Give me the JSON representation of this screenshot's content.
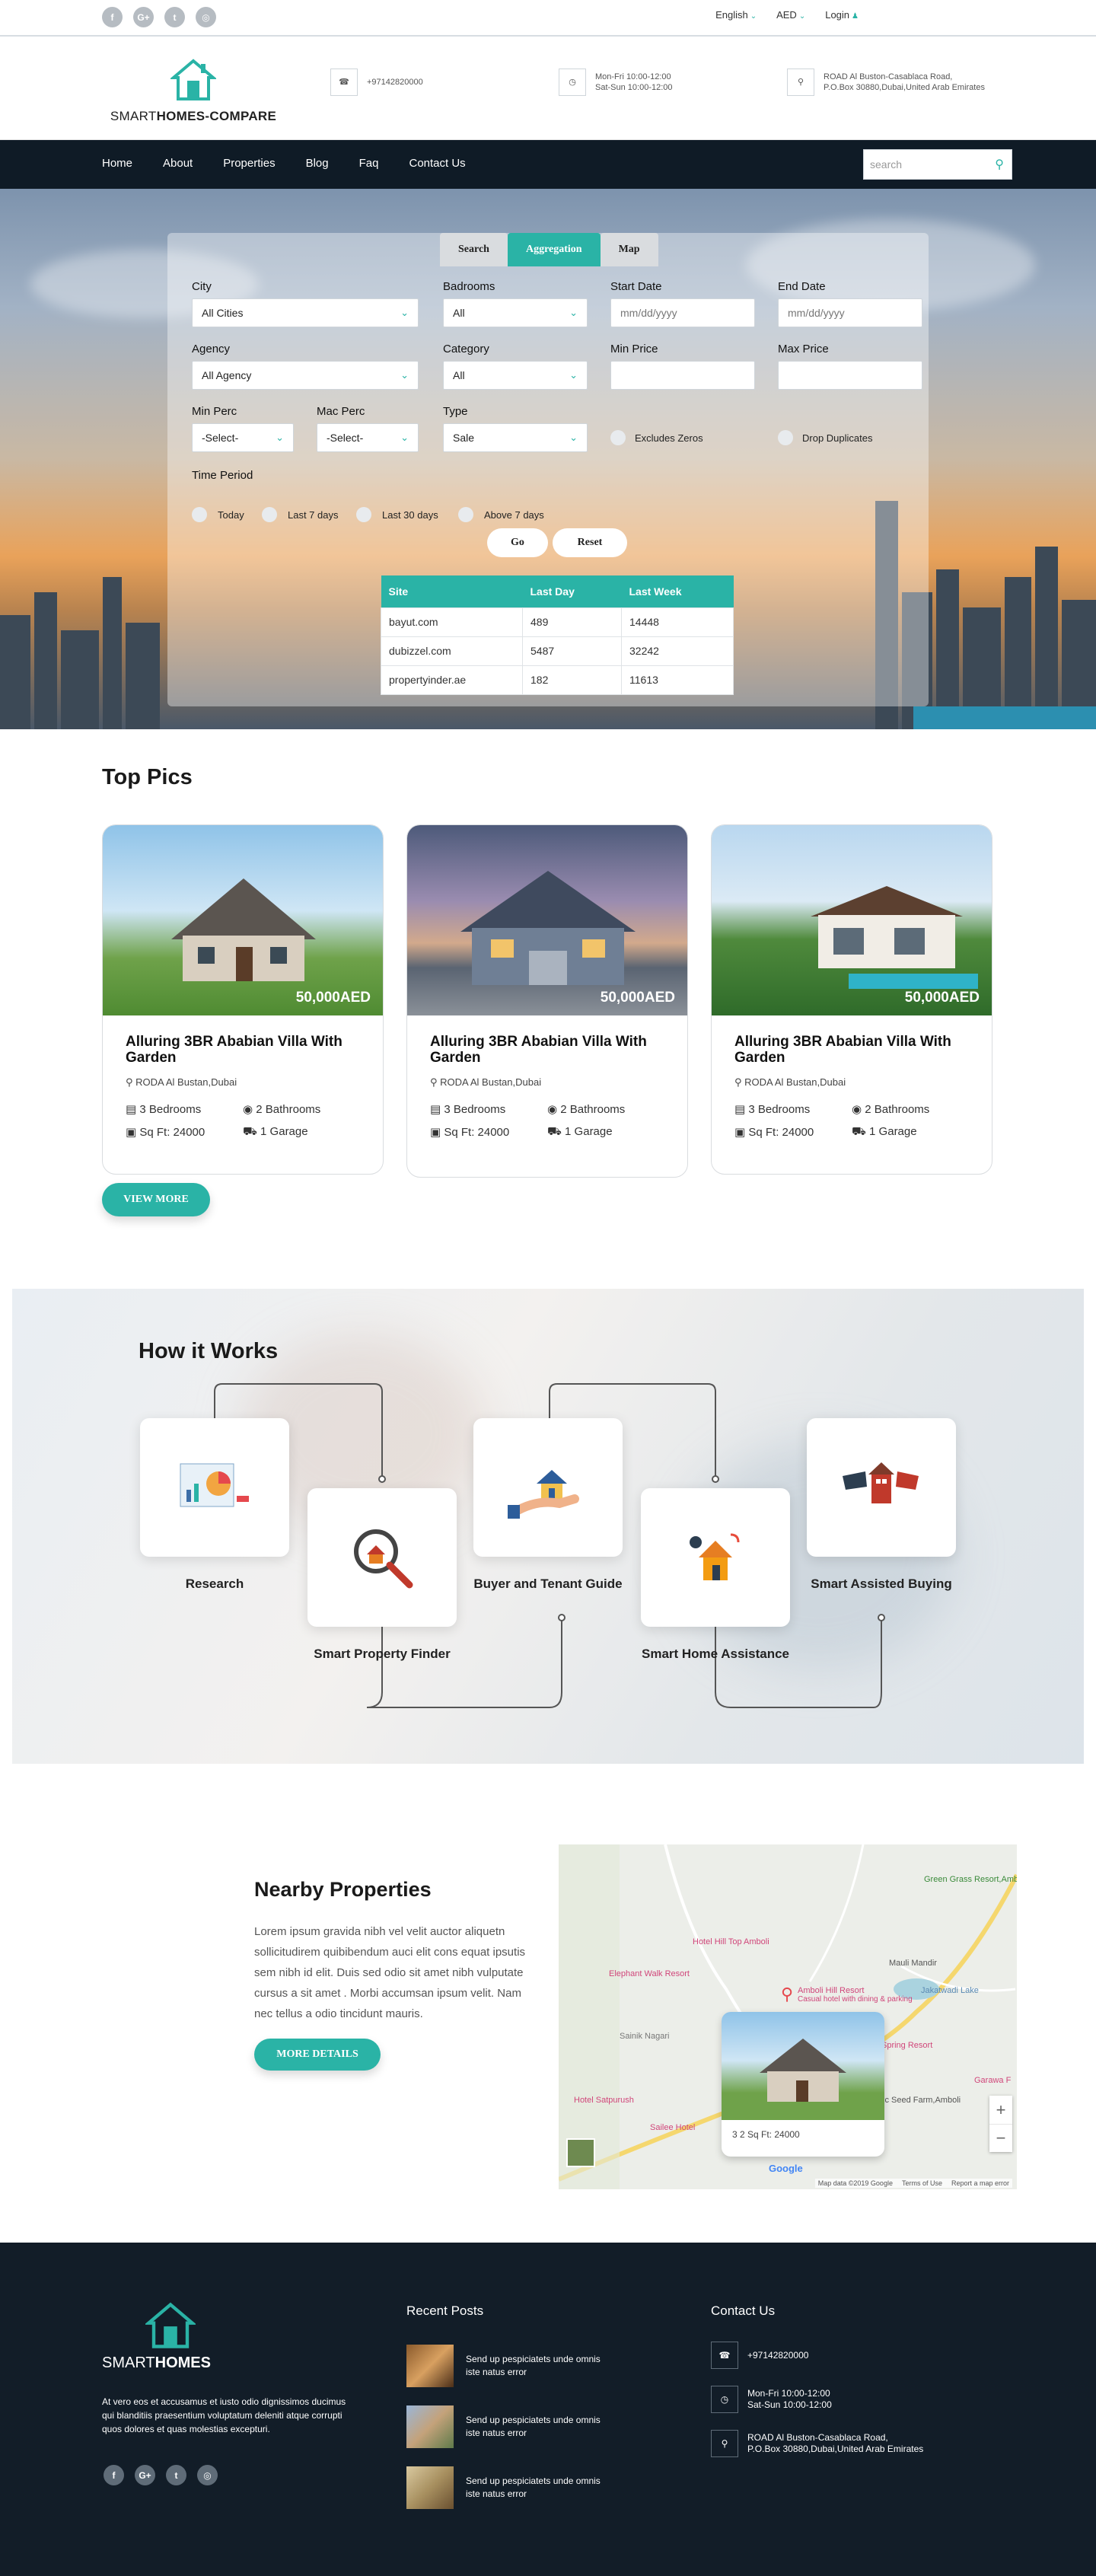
{
  "social": [
    "f",
    "G+",
    "t",
    "◎"
  ],
  "topbar": {
    "language": "English",
    "currency": "AED",
    "login": "Login"
  },
  "header": {
    "logo_text_1": "SMART",
    "logo_text_2": "HOMES-COMPARE",
    "phone": "+97142820000",
    "hours_1": "Mon-Fri 10:00-12:00",
    "hours_2": "Sat-Sun 10:00-12:00",
    "address_1": "ROAD Al Buston-Casablaca Road,",
    "address_2": "P.O.Box 30880,Dubai,United Arab Emirates"
  },
  "nav": {
    "items": [
      "Home",
      "About",
      "Properties",
      "Blog",
      "Faq",
      "Contact Us"
    ],
    "search_placeholder": "search"
  },
  "search_panel": {
    "tabs": [
      "Search",
      "Aggregation",
      "Map"
    ],
    "labels": {
      "city": "City",
      "bedrooms": "Badrooms",
      "start": "Start Date",
      "end": "End Date",
      "agency": "Agency",
      "category": "Category",
      "minprice": "Min Price",
      "maxprice": "Max Price",
      "minperc": "Min Perc",
      "macperc": "Mac Perc",
      "type": "Type",
      "time": "Time Period"
    },
    "values": {
      "city": "All Cities",
      "bedrooms": "All",
      "start": "mm/dd/yyyy",
      "end": "mm/dd/yyyy",
      "agency": "All Agency",
      "category": "All",
      "minperc": "-Select-",
      "macperc": "-Select-",
      "type": "Sale"
    },
    "checks": [
      "Excludes Zeros",
      "Drop Duplicates"
    ],
    "periods": [
      "Today",
      "Last 7 days",
      "Last 30 days",
      "Above 7 days"
    ],
    "go": "Go",
    "reset": "Reset",
    "table": {
      "headers": [
        "Site",
        "Last Day",
        "Last Week"
      ],
      "rows": [
        [
          "bayut.com",
          "489",
          "14448"
        ],
        [
          "dubizzel.com",
          "5487",
          "32242"
        ],
        [
          "propertyinder.ae",
          "182",
          "11613"
        ]
      ]
    }
  },
  "top_pics": {
    "title": "Top Pics",
    "cards": [
      {
        "price": "50,000AED",
        "title": "Alluring 3BR Ababian Villa With Garden",
        "location": "RODA Al Bustan,Dubai",
        "bed": "3 Bedrooms",
        "bath": "2 Bathrooms",
        "sqft": "Sq Ft: 24000",
        "garage": "1 Garage"
      },
      {
        "price": "50,000AED",
        "title": "Alluring 3BR Ababian Villa With Garden",
        "location": "RODA Al Bustan,Dubai",
        "bed": "3 Bedrooms",
        "bath": "2 Bathrooms",
        "sqft": "Sq Ft: 24000",
        "garage": "1 Garage"
      },
      {
        "price": "50,000AED",
        "title": "Alluring 3BR Ababian Villa With Garden",
        "location": "RODA Al Bustan,Dubai",
        "bed": "3 Bedrooms",
        "bath": "2 Bathrooms",
        "sqft": "Sq Ft: 24000",
        "garage": "1 Garage"
      }
    ],
    "view_more": "VIEW MORE"
  },
  "how": {
    "title": "How it Works",
    "steps": [
      "Research",
      "Smart Property Finder",
      "Buyer and Tenant Guide",
      "Smart Home Assistance",
      "Smart Assisted Buying"
    ]
  },
  "nearby": {
    "title": "Nearby Properties",
    "text": "Lorem ipsum gravida nibh vel velit auctor aliquetn sollicitudirem quibibendum auci elit cons equat ipsutis sem nibh id elit. Duis sed odio sit amet nibh vulputate cursus a sit amet . Morbi accumsan ipsum velit. Nam nec tellus a odio tincidunt mauris.",
    "button": "MORE DETAILS",
    "map": {
      "labels": [
        "Green Grass Resort,Amboli",
        "Hotel Hill Top Amboli",
        "Elephant Walk Resort",
        "Mauli Mandir",
        "Amboli Hill Resort",
        "Casual hotel with dining & parking",
        "Jakatwadi Lake",
        "Sainik Nagari",
        "Hotel Satpurush",
        "Sailee Hotel",
        "Spring Resort",
        "Garawa F",
        "ic Seed Farm,Amboli",
        "Google"
      ],
      "popup_stats": "3   2   Sq Ft: 24000",
      "zoom_in": "+",
      "zoom_out": "−",
      "footer_links": [
        "Map data ©2019 Google",
        "Terms of Use",
        "Report a map error"
      ]
    }
  },
  "footer": {
    "logo_1": "SMART",
    "logo_2": "HOMES",
    "about": "At vero eos et accusamus et iusto odio dignissimos ducimus qui blanditiis praesentium voluptatum deleniti atque corrupti quos dolores et quas molestias excepturi.",
    "recent_title": "Recent Posts",
    "posts": [
      "Send up pespiciatets unde omnis iste natus error",
      "Send up pespiciatets unde omnis iste natus error",
      "Send up pespiciatets unde omnis iste natus error"
    ],
    "contact_title": "Contact Us",
    "phone": "+97142820000",
    "hours_1": "Mon-Fri 10:00-12:00",
    "hours_2": "Sat-Sun 10:00-12:00",
    "address_1": "ROAD Al Buston-Casablaca Road,",
    "address_2": "P.O.Box 30880,Dubai,United Arab Emirates"
  },
  "colors": {
    "accent": "#2ab3a6",
    "nav": "#0f1b26",
    "footer": "#121d28"
  }
}
